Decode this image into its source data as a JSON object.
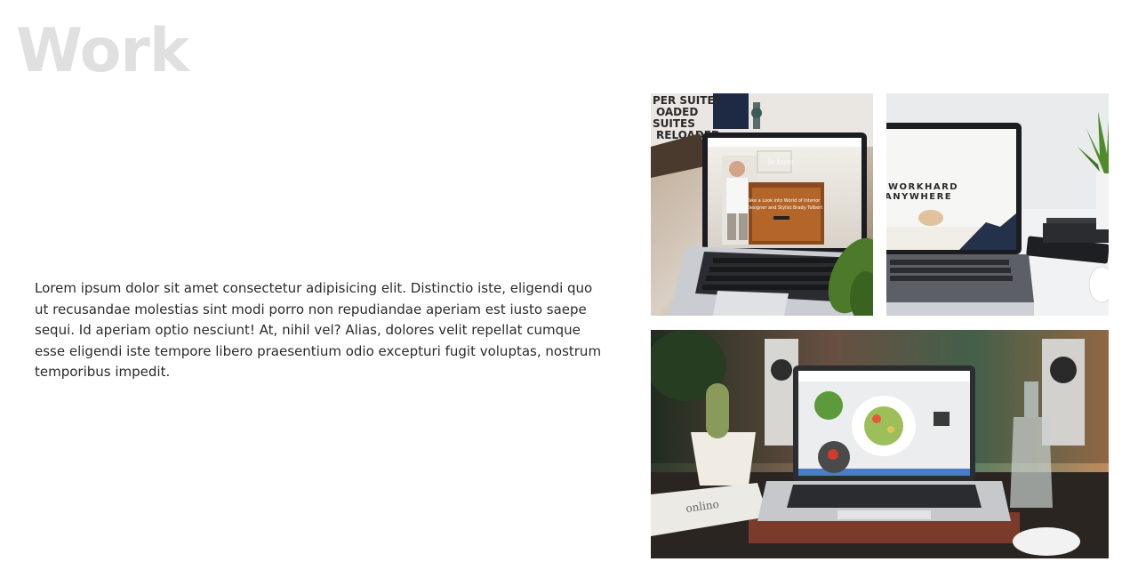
{
  "work": {
    "title": "Work",
    "description": "Lorem ipsum dolor sit amet consectetur adipisicing elit. Distinctio iste, eligendi quo ut recusandae molestias sint modi porro non repudiandae aperiam est iusto saepe sequi. Id aperiam optio nesciunt! At, nihil vel? Alias, dolores velit repellat cumque esse eligendi iste tempore libero praesentium odio excepturi fugit voluptas, nostrum temporibus impedit."
  },
  "gallery": {
    "items": [
      {
        "screen_headline_1": "Take a Look into World of Interior",
        "screen_headline_2": "Designer and Stylist Brady Tolbert",
        "poster_lines": [
          "PER SUITES",
          "OADED",
          "SUITES",
          "RELOADED"
        ]
      },
      {
        "screen_headline_1": "WORKHARD",
        "screen_headline_2": "ANYWHERE"
      },
      {
        "newspaper_text": "onlino"
      }
    ]
  }
}
